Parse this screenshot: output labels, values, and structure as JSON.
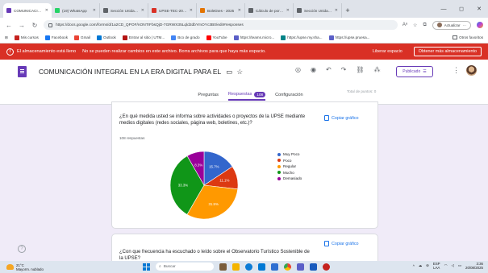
{
  "browser": {
    "tabs": [
      {
        "label": "COMUNICACIÓN",
        "icon": "forms-icon",
        "color": "#673ab7",
        "active": true
      },
      {
        "label": "(19) WhatsApp",
        "icon": "whatsapp-icon",
        "color": "#25d366",
        "active": false
      },
      {
        "label": "Sección Unidad 3",
        "icon": "globe-icon",
        "color": "#5f6368",
        "active": false
      },
      {
        "label": "UPSE-TEC-2025-I",
        "icon": "doc-icon",
        "color": "#d93025",
        "active": false
      },
      {
        "label": "Boletines - 2025",
        "icon": "globe-icon",
        "color": "#e37400",
        "active": false
      },
      {
        "label": "Cálculo de porcen",
        "icon": "globe-icon",
        "color": "#5f6368",
        "active": false
      },
      {
        "label": "Sección Unidad 3",
        "icon": "globe-icon",
        "color": "#5f6368",
        "active": false
      }
    ],
    "url": "https://docs.google.com/forms/d/1a2CD_QPOF/nONTrFbsQjD-7GRWX35Lqld2dbYmOYc3B0/edit#responses",
    "profile_label": "Actualizar",
    "bookmarks": [
      {
        "label": "Mis cursos",
        "color": "#c5221f"
      },
      {
        "label": "Facebook",
        "color": "#1877f2"
      },
      {
        "label": "Gmail",
        "color": "#ea4335"
      },
      {
        "label": "Outlook",
        "color": "#0078d4"
      },
      {
        "label": "Entrar al sitio | UTM...",
        "color": "#b31412"
      },
      {
        "label": "Bco de grado",
        "color": "#4285f4"
      },
      {
        "label": "YouTube",
        "color": "#ff0000"
      },
      {
        "label": "https://teams.micro...",
        "color": "#5b5fc7"
      },
      {
        "label": "https://upse.my.sha...",
        "color": "#038387"
      },
      {
        "label": "https://upse.pruesa...",
        "color": "#5b5fc7"
      }
    ],
    "other_favorites": "Otros favoritos"
  },
  "alert": {
    "title": "El almacenamiento está lleno",
    "message": "No se pueden realizar cambios en este archivo. Borra archivos para que haya más espacio.",
    "free_space": "Liberar espacio",
    "get_more": "Obtener más almacenamiento"
  },
  "form": {
    "title": "COMUNICACIÓN INTEGRAL EN LA ERA DIGITAL PARA EL",
    "publish_label": "Publicado",
    "tabs": {
      "questions": "Preguntas",
      "responses": "Respuestas",
      "responses_count": "108",
      "settings": "Configuración"
    },
    "total_points": "Total de puntos: 0"
  },
  "question1": {
    "text": "¿En qué medida usted se informa sobre actividades o proyectos de la UPSE mediante medios digitales (redes sociales, página web, boletines, etc.)?",
    "responses": "108 respuestas",
    "copy_label": "Copiar gráfico"
  },
  "question2": {
    "text": "¿Con que frecuencia ha escuchado o leído sobre el Observatorio Turístico Sostenible de la UPSE?",
    "copy_label": "Copiar gráfico"
  },
  "chart_data": {
    "type": "pie",
    "categories": [
      "Muy Poco",
      "Poco",
      "Regular",
      "Mucho",
      "Demasiado"
    ],
    "values": [
      15.7,
      11.1,
      31.5,
      33.3,
      8.3
    ],
    "labels": [
      "15.7%",
      "11.1%",
      "31.5%",
      "33.3%",
      "8.3%"
    ],
    "colors": [
      "#3366cc",
      "#dc3912",
      "#ff9900",
      "#109618",
      "#990099"
    ],
    "legend_position": "right"
  },
  "taskbar": {
    "temp": "21°C",
    "weather": "Mayorm. nublado",
    "search_placeholder": "Buscar",
    "lang": "ESP",
    "lang2": "LAA",
    "time": "3:36",
    "date": "20/08/2025"
  }
}
